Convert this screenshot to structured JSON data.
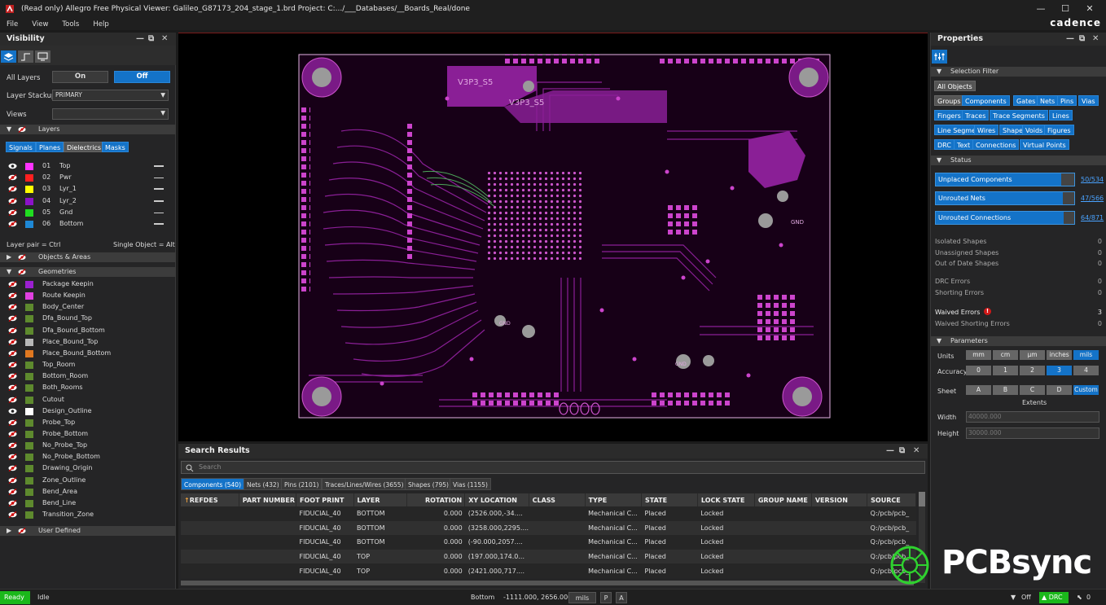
{
  "window": {
    "title": "(Read only) Allegro Free Physical Viewer: Galileo_G87173_204_stage_1.brd  Project: C:.../___Databases/__Boards_Real/done",
    "brand": "cadence"
  },
  "menu": [
    "File",
    "View",
    "Tools",
    "Help"
  ],
  "visibility": {
    "title": "Visibility",
    "all_layers_label": "All Layers",
    "on_label": "On",
    "off_label": "Off",
    "layer_stackup_label": "Layer Stackup",
    "layer_stackup_value": "PRIMARY",
    "views_label": "Views",
    "layers_section": "Layers",
    "filters": [
      "Signals",
      "Planes",
      "Dielectrics",
      "Masks"
    ],
    "layers": [
      {
        "num": "01",
        "name": "Top",
        "color": "#ff33ff"
      },
      {
        "num": "02",
        "name": "Pwr",
        "color": "#ff2020"
      },
      {
        "num": "03",
        "name": "Lyr_1",
        "color": "#ffff00"
      },
      {
        "num": "04",
        "name": "Lyr_2",
        "color": "#8b12c8"
      },
      {
        "num": "05",
        "name": "Gnd",
        "color": "#20dd20"
      },
      {
        "num": "06",
        "name": "Bottom",
        "color": "#1e88d6"
      }
    ],
    "layer_pair": "Layer pair = Ctrl",
    "single_object": "Single Object = Alt",
    "objects_section": "Objects & Areas",
    "geometries_section": "Geometries",
    "geometries": [
      {
        "name": "Package Keepin",
        "color": "#9b20d0"
      },
      {
        "name": "Route Keepin",
        "color": "#e040e0"
      },
      {
        "name": "Body_Center",
        "color": "#5e8a2e"
      },
      {
        "name": "Dfa_Bound_Top",
        "color": "#5e8a2e"
      },
      {
        "name": "Dfa_Bound_Bottom",
        "color": "#5e8a2e"
      },
      {
        "name": "Place_Bound_Top",
        "color": "#b8b8b8"
      },
      {
        "name": "Place_Bound_Bottom",
        "color": "#e07820"
      },
      {
        "name": "Top_Room",
        "color": "#5e8a2e"
      },
      {
        "name": "Bottom_Room",
        "color": "#5e8a2e"
      },
      {
        "name": "Both_Rooms",
        "color": "#5e8a2e"
      },
      {
        "name": "Cutout",
        "color": "#5e8a2e"
      },
      {
        "name": "Design_Outline",
        "color": "#ffffff"
      },
      {
        "name": "Probe_Top",
        "color": "#5e8a2e"
      },
      {
        "name": "Probe_Bottom",
        "color": "#5e8a2e"
      },
      {
        "name": "No_Probe_Top",
        "color": "#5e8a2e"
      },
      {
        "name": "No_Probe_Bottom",
        "color": "#5e8a2e"
      },
      {
        "name": "Drawing_Origin",
        "color": "#5e8a2e"
      },
      {
        "name": "Zone_Outline",
        "color": "#5e8a2e"
      },
      {
        "name": "Bend_Area",
        "color": "#5e8a2e"
      },
      {
        "name": "Bend_Line",
        "color": "#5e8a2e"
      },
      {
        "name": "Transition_Zone",
        "color": "#5e8a2e"
      }
    ],
    "user_defined_section": "User Defined"
  },
  "board": {
    "labels": [
      "V3P3_S5",
      "V3P3_S5",
      "GND",
      "GND",
      "GND"
    ]
  },
  "search_results": {
    "title": "Search Results",
    "placeholder": "Search",
    "tabs": [
      "Components (540)",
      "Nets (432)",
      "Pins (2101)",
      "Traces/Lines/Wires (3655)",
      "Shapes (795)",
      "Vias (1155)"
    ],
    "columns": [
      "REFDES",
      "PART NUMBER",
      "FOOT PRINT",
      "LAYER",
      "ROTATION",
      "XY LOCATION",
      "CLASS",
      "TYPE",
      "STATE",
      "LOCK STATE",
      "GROUP NAME",
      "VERSION",
      "SOURCE"
    ],
    "rows": [
      [
        "",
        "",
        "FIDUCIAL_40",
        "BOTTOM",
        "0.000",
        "(2526.000,-34....",
        "",
        "Mechanical C...",
        "Placed",
        "Locked",
        "",
        "",
        "Q:/pcb/pcb_"
      ],
      [
        "",
        "",
        "FIDUCIAL_40",
        "BOTTOM",
        "0.000",
        "(3258.000,2295....",
        "",
        "Mechanical C...",
        "Placed",
        "Locked",
        "",
        "",
        "Q:/pcb/pcb_"
      ],
      [
        "",
        "",
        "FIDUCIAL_40",
        "BOTTOM",
        "0.000",
        "(-90.000,2057....",
        "",
        "Mechanical C...",
        "Placed",
        "Locked",
        "",
        "",
        "Q:/pcb/pcb_"
      ],
      [
        "",
        "",
        "FIDUCIAL_40",
        "TOP",
        "0.000",
        "(197.000,174.0...",
        "",
        "Mechanical C...",
        "Placed",
        "Locked",
        "",
        "",
        "Q:/pcb/pcb_"
      ],
      [
        "",
        "",
        "FIDUCIAL_40",
        "TOP",
        "0.000",
        "(2421.000,717....",
        "",
        "Mechanical C...",
        "Placed",
        "Locked",
        "",
        "",
        "Q:/pcb/pcb_"
      ]
    ]
  },
  "properties": {
    "title": "Properties",
    "selection_filter": "Selection Filter",
    "all_objects": "All Objects",
    "filters": [
      [
        "Groups",
        "Components",
        "Gates",
        "Nets",
        "Pins",
        "Vias"
      ],
      [
        "Fingers",
        "Traces",
        "Trace Segments",
        "Lines"
      ],
      [
        "Line Segments",
        "Wires",
        "Shapes",
        "Voids",
        "Figures"
      ],
      [
        "DRC",
        "Text",
        "Connections",
        "Virtual Points"
      ]
    ],
    "status_section": "Status",
    "status_bars": [
      {
        "label": "Unplaced Components",
        "count": "50/534",
        "fraction": 0.906
      },
      {
        "label": "Unrouted Nets",
        "count": "47/566",
        "fraction": 0.917
      },
      {
        "label": "Unrouted Connections",
        "count": "64/871",
        "fraction": 0.927
      }
    ],
    "status_rows": [
      [
        "Isolated Shapes",
        "0"
      ],
      [
        "Unassigned Shapes",
        "0"
      ],
      [
        "Out of Date Shapes",
        "0"
      ],
      [
        "DRC Errors",
        "0"
      ],
      [
        "Shorting Errors",
        "0"
      ],
      [
        "Waived Errors",
        "3"
      ],
      [
        "Waived Shorting Errors",
        "0"
      ]
    ],
    "parameters_section": "Parameters",
    "units_label": "Units",
    "units": [
      "mm",
      "cm",
      "µm",
      "inches",
      "mils"
    ],
    "units_selected": "mils",
    "accuracy_label": "Accuracy",
    "accuracy": [
      "0",
      "1",
      "2",
      "3",
      "4"
    ],
    "accuracy_selected": "3",
    "sheet_label": "Sheet",
    "sheets": [
      "A",
      "B",
      "C",
      "D",
      "Custom"
    ],
    "sheet_selected": "Custom",
    "extents_label": "Extents",
    "width_label": "Width",
    "width_value": "40000.000",
    "height_label": "Height",
    "height_value": "30000.000"
  },
  "statusbar": {
    "ready": "Ready",
    "idle": "Idle",
    "layer": "Bottom",
    "coords": "-1111.000, 2656.000",
    "units": "mils",
    "p": "P",
    "a": "A",
    "filter": "Off",
    "drc": "DRC",
    "sel": "0"
  },
  "watermark": "PCBsync"
}
